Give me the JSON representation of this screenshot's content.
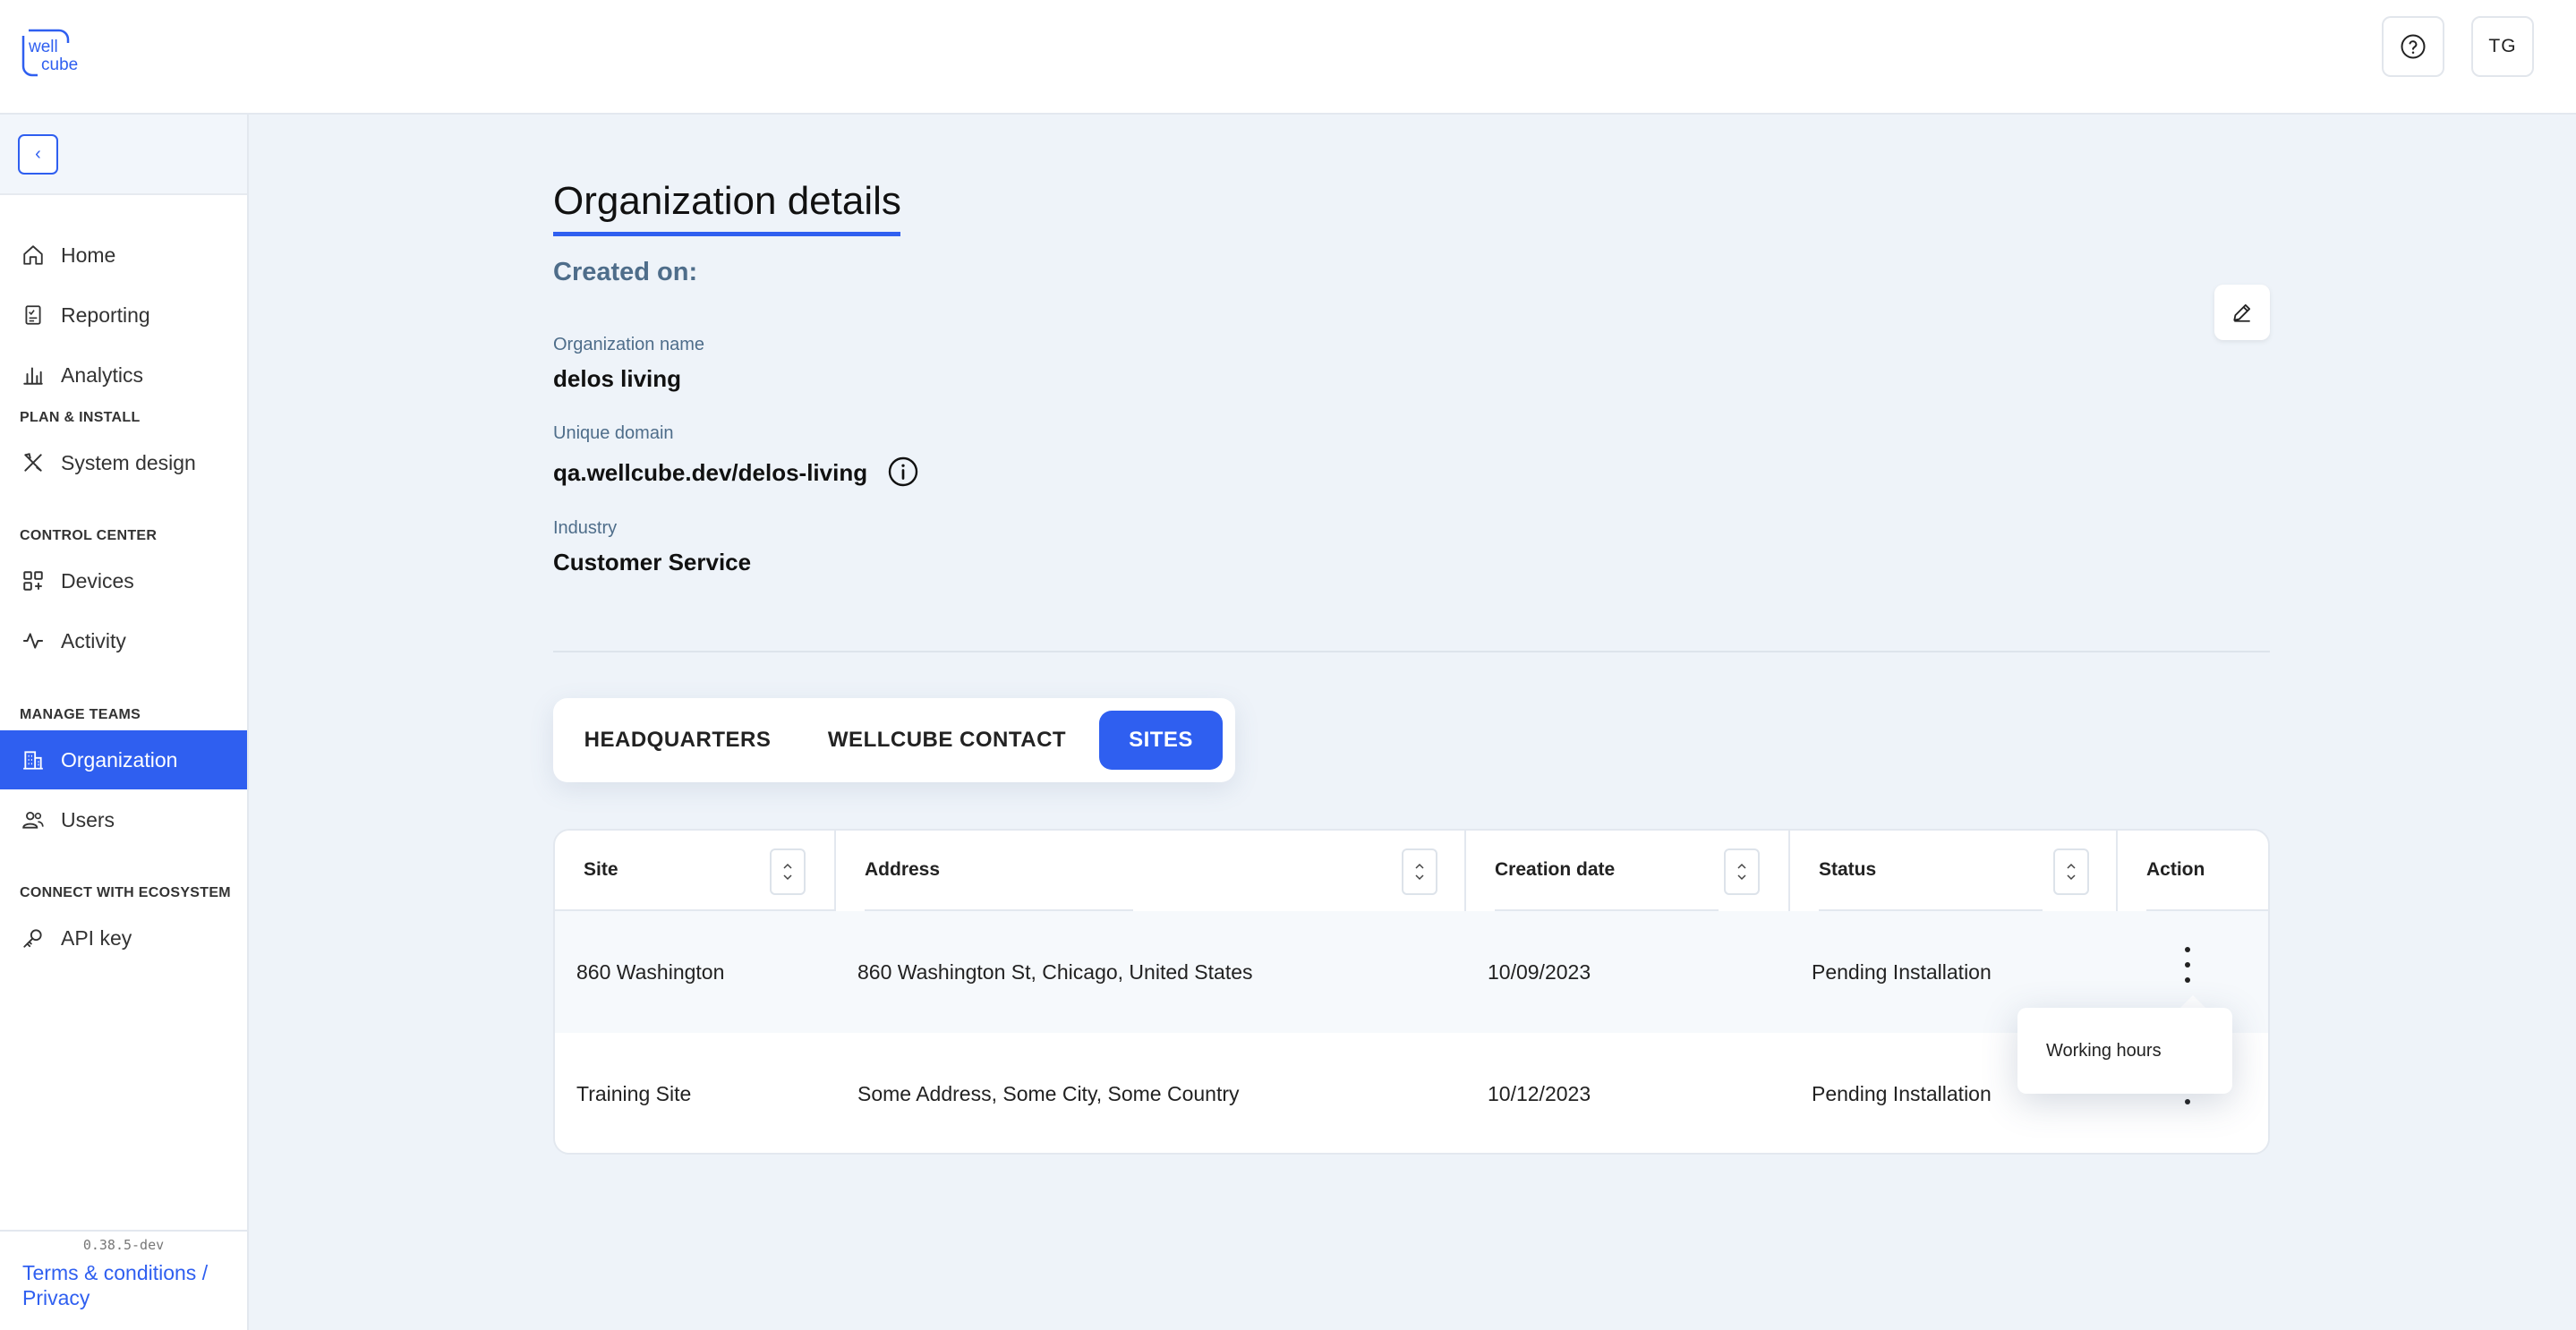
{
  "brand": {
    "logo_line1": "well",
    "logo_line2": "cube",
    "accent": "#2f5ff0"
  },
  "header": {
    "help_icon": "question-circle-icon",
    "avatar_initials": "TG"
  },
  "sidebar": {
    "collapse_icon": "chevron-left-icon",
    "items": [
      {
        "label": "Home",
        "icon": "home-icon"
      },
      {
        "label": "Reporting",
        "icon": "report-icon"
      },
      {
        "label": "Analytics",
        "icon": "bar-chart-icon"
      }
    ],
    "sections": [
      {
        "title": "PLAN & INSTALL",
        "items": [
          {
            "label": "System design",
            "icon": "tools-icon"
          }
        ]
      },
      {
        "title": "CONTROL CENTER",
        "items": [
          {
            "label": "Devices",
            "icon": "devices-icon"
          },
          {
            "label": "Activity",
            "icon": "activity-icon"
          }
        ]
      },
      {
        "title": "MANAGE TEAMS",
        "items": [
          {
            "label": "Organization",
            "icon": "building-icon",
            "active": true
          },
          {
            "label": "Users",
            "icon": "users-icon"
          }
        ]
      },
      {
        "title": "CONNECT WITH ECOSYSTEM",
        "items": [
          {
            "label": "API key",
            "icon": "key-icon"
          }
        ]
      }
    ],
    "version": "0.38.5-dev",
    "terms_label": "Terms & conditions / Privacy"
  },
  "main": {
    "title": "Organization details",
    "created_on": "Created on:",
    "fields": [
      {
        "label": "Organization name",
        "value": "delos living"
      },
      {
        "label": "Unique domain",
        "value": "qa.wellcube.dev/delos-living"
      },
      {
        "label": "Industry",
        "value": "Customer Service"
      }
    ],
    "tabs": [
      {
        "label": "HEADQUARTERS"
      },
      {
        "label": "WELLCUBE CONTACT"
      },
      {
        "label": "SITES",
        "active": true
      }
    ],
    "table": {
      "columns": [
        "Site",
        "Address",
        "Creation date",
        "Status",
        "Action"
      ],
      "rows": [
        {
          "site": "860 Washington",
          "address": "860 Washington St, Chicago, United States",
          "created": "10/09/2023",
          "status": "Pending Installation"
        },
        {
          "site": "Training Site",
          "address": "Some Address, Some City, Some Country",
          "created": "10/12/2023",
          "status": "Pending Installation"
        }
      ]
    },
    "action_menu": {
      "items": [
        "Working hours"
      ]
    }
  }
}
